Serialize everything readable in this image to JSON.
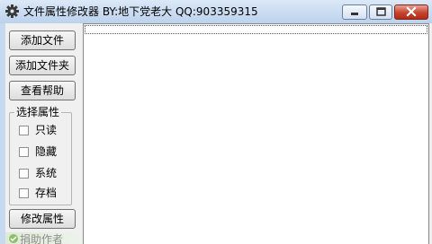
{
  "window": {
    "title": "文件属性修改器 BY:地下党老大 QQ:903359315"
  },
  "buttons": {
    "add_file": "添加文件",
    "add_folder": "添加文件夹",
    "view_help": "查看帮助",
    "modify_attributes": "修改属性"
  },
  "attributes_group": {
    "title": "选择属性",
    "options": [
      {
        "label": "只读",
        "checked": false
      },
      {
        "label": "隐藏",
        "checked": false
      },
      {
        "label": "系统",
        "checked": false
      },
      {
        "label": "存档",
        "checked": false
      }
    ]
  },
  "donate": {
    "label": "捐助作者"
  },
  "icons": {
    "app": "gear-icon",
    "minimize": "minimize-icon",
    "maximize": "maximize-icon",
    "close": "close-icon",
    "donate": "donate-icon"
  },
  "colors": {
    "titlebar": "#c7d9ee",
    "close_button": "#c7432d",
    "client": "#f0f0f0"
  }
}
